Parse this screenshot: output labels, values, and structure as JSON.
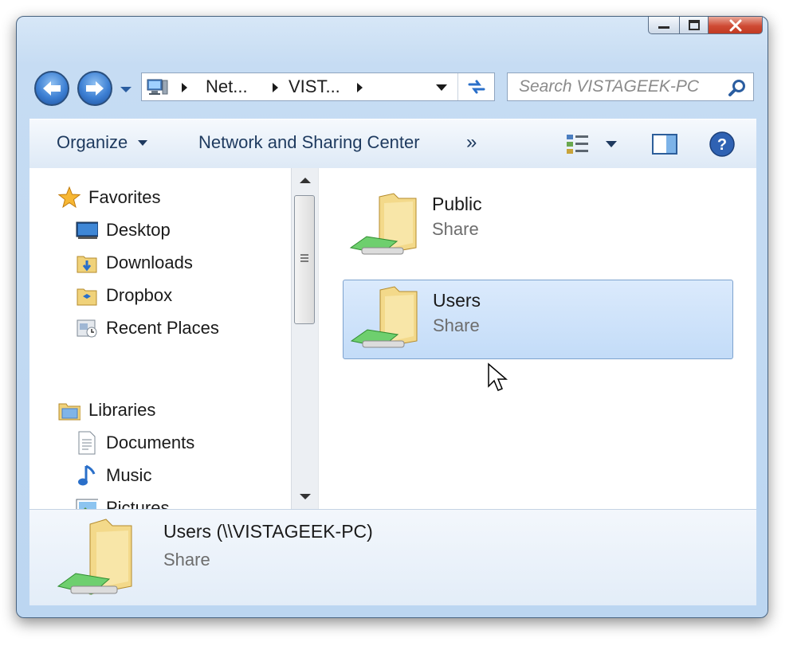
{
  "titlebar": {
    "minimize_label": "minimize",
    "maximize_label": "maximize",
    "close_label": "close"
  },
  "address": {
    "crumbs": [
      "Net...",
      "VIST..."
    ]
  },
  "search": {
    "placeholder": "Search VISTAGEEK-PC"
  },
  "toolbar": {
    "organize": "Organize",
    "network_center": "Network and Sharing Center",
    "more": "»"
  },
  "nav": {
    "favorites": "Favorites",
    "desktop": "Desktop",
    "downloads": "Downloads",
    "dropbox": "Dropbox",
    "recent": "Recent Places",
    "libraries": "Libraries",
    "documents": "Documents",
    "music": "Music",
    "pictures": "Pictures"
  },
  "files": [
    {
      "name": "Public",
      "type": "Share"
    },
    {
      "name": "Users",
      "type": "Share"
    }
  ],
  "details": {
    "title": "Users (\\\\VISTAGEEK-PC)",
    "subtitle": "Share"
  },
  "colors": {
    "accent": "#3c7fd3",
    "selection": "#c3dcf8"
  }
}
